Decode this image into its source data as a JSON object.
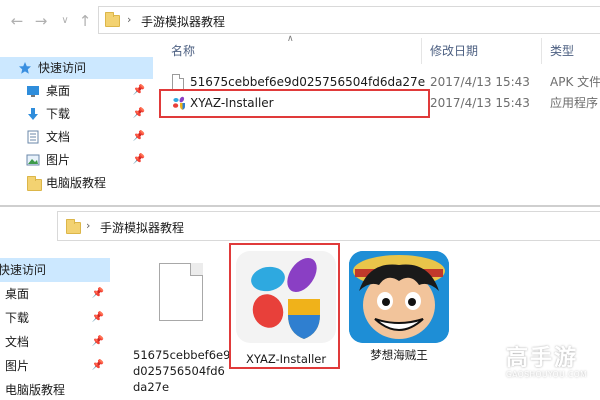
{
  "top_window": {
    "breadcrumb_folder": "手游模拟器教程",
    "nav": [
      {
        "label": "快速访问",
        "icon": "star-icon",
        "pinned": false,
        "selected": true
      },
      {
        "label": "桌面",
        "icon": "desktop-icon",
        "pinned": true,
        "selected": false
      },
      {
        "label": "下载",
        "icon": "download-icon",
        "pinned": true,
        "selected": false
      },
      {
        "label": "文档",
        "icon": "documents-icon",
        "pinned": true,
        "selected": false
      },
      {
        "label": "图片",
        "icon": "pictures-icon",
        "pinned": true,
        "selected": false
      },
      {
        "label": "电脑版教程",
        "icon": "folder-icon",
        "pinned": false,
        "selected": false
      }
    ],
    "columns": {
      "name": "名称",
      "date": "修改日期",
      "type": "类型"
    },
    "files": [
      {
        "name": "51675cebbef6e9d025756504fd6da27e",
        "date": "2017/4/13 15:43",
        "type": "APK 文件",
        "icon": "document-icon"
      },
      {
        "name": "XYAZ-Installer",
        "date": "2017/4/13 15:43",
        "type": "应用程序",
        "icon": "xyaz-app-icon",
        "highlighted": true
      }
    ]
  },
  "bottom_window": {
    "breadcrumb_folder": "手游模拟器教程",
    "nav": [
      {
        "label": "快速访问",
        "pinned": false,
        "selected": true
      },
      {
        "label": "桌面",
        "pinned": true,
        "selected": false
      },
      {
        "label": "下载",
        "pinned": true,
        "selected": false
      },
      {
        "label": "文档",
        "pinned": true,
        "selected": false
      },
      {
        "label": "图片",
        "pinned": true,
        "selected": false
      },
      {
        "label": "电脑版教程",
        "pinned": false,
        "selected": false
      }
    ],
    "tiles": [
      {
        "caption": "51675cebbef6e9d025756504fd6da27e",
        "icon": "document-icon"
      },
      {
        "caption": "XYAZ-Installer",
        "icon": "xyaz-app-icon",
        "highlighted": true
      },
      {
        "caption": "梦想海贼王",
        "icon": "game-icon"
      }
    ]
  },
  "watermark": {
    "brand": "高手游",
    "domain": "GAOSHOUYOU.COM"
  },
  "colors": {
    "highlight_red": "#e03a3a",
    "selection_blue": "#cce8ff",
    "header_text": "#4d6082"
  }
}
